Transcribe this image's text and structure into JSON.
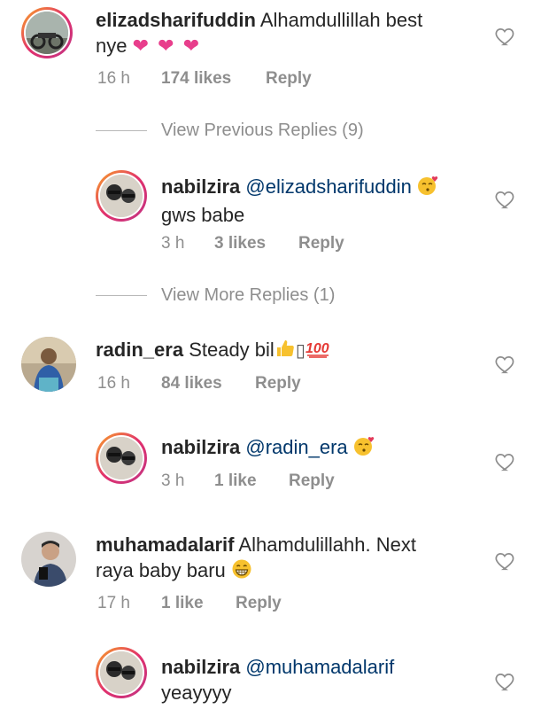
{
  "comments": [
    {
      "username": "elizadsharifuddin",
      "text_line1": "Alhamdullillah best",
      "text_line2": "nye",
      "hearts": "❤ ❤ ❤",
      "time": "16 h",
      "likes": "174 likes",
      "reply": "Reply"
    },
    {
      "username": "nabilzira",
      "mention": "@elizadsharifuddin",
      "text_line2": "gws babe",
      "time": "3 h",
      "likes": "3 likes",
      "reply": "Reply"
    },
    {
      "username": "radin_era",
      "text": "Steady bil",
      "glyph": "▯",
      "time": "16 h",
      "likes": "84 likes",
      "reply": "Reply"
    },
    {
      "username": "nabilzira",
      "mention": "@radin_era",
      "time": "3 h",
      "likes": "1 like",
      "reply": "Reply"
    },
    {
      "username": "muhamadalarif",
      "text_line1": "Alhamdulillahh. Next",
      "text_line2": "raya baby baru",
      "time": "17 h",
      "likes": "1 like",
      "reply": "Reply"
    },
    {
      "username": "nabilzira",
      "mention": "@muhamadalarif",
      "text_line2": "yeayyyy"
    }
  ],
  "view_previous": "View Previous Replies (9)",
  "view_more": "View More Replies (1)",
  "icons": {
    "heart_outline": "heart-icon",
    "kiss_emoji": "kissing-face-icon",
    "thumbs_emoji": "thumbs-up-icon",
    "hundred_emoji": "hundred-points-icon",
    "grin_emoji": "grinning-face-icon"
  },
  "colors": {
    "text": "#262626",
    "meta": "#8e8e8e",
    "mention": "#00376b",
    "heart_pink": "#e83e8c"
  }
}
